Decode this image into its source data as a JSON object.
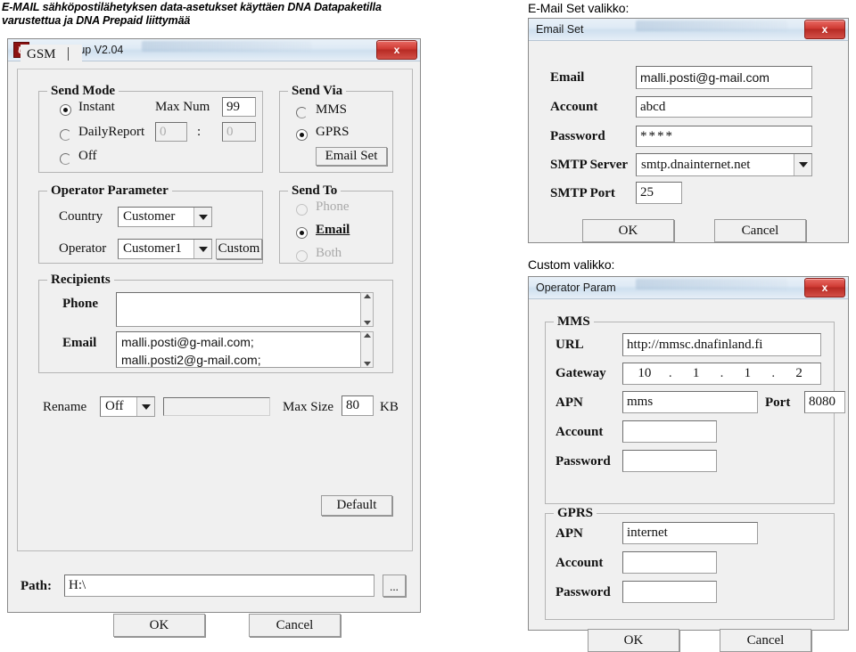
{
  "captions": {
    "heading_line1": "E-MAIL sähköpostilähetyksen data-asetukset käyttäen DNA Datapaketilla",
    "heading_line2": "varustettua ja DNA Prepaid liittymää",
    "email_set_caption": "E-Mail Set valikko:",
    "custom_caption": "Custom valikko:"
  },
  "main_window": {
    "title": "UOV Setup V2.04",
    "app_icon_letter": "U",
    "close_label": "x",
    "tab": {
      "label": "GSM"
    },
    "send_mode": {
      "legend": "Send Mode",
      "options": [
        {
          "label": "Instant",
          "selected": true,
          "disabled": false
        },
        {
          "label": "DailyReport",
          "selected": false,
          "disabled": false
        },
        {
          "label": "Off",
          "selected": false,
          "disabled": false
        }
      ],
      "max_num_label": "Max Num",
      "max_num_value": "99",
      "daily_hour_value": "0",
      "daily_separator": ":",
      "daily_minute_value": "0"
    },
    "send_via": {
      "legend": "Send Via",
      "options": [
        {
          "label": "MMS",
          "selected": false
        },
        {
          "label": "GPRS",
          "selected": true
        }
      ],
      "email_set_button": "Email Set"
    },
    "send_to": {
      "legend": "Send To",
      "options": [
        {
          "label": "Phone",
          "selected": false,
          "disabled": true
        },
        {
          "label": "Email",
          "selected": true,
          "disabled": false
        },
        {
          "label": "Both",
          "selected": false,
          "disabled": true
        }
      ]
    },
    "operator_parameter": {
      "legend": "Operator Parameter",
      "country_label": "Country",
      "country_value": "Customer",
      "operator_label": "Operator",
      "operator_value": "Customer1",
      "custom_button": "Custom"
    },
    "recipients": {
      "legend": "Recipients",
      "phone_label": "Phone",
      "phone_value": "",
      "email_label": "Email",
      "email_line1": "malli.posti@g-mail.com;",
      "email_line2": "malli.posti2@g-mail.com;"
    },
    "rename_row": {
      "rename_label": "Rename",
      "rename_value": "Off",
      "rename_text_value": "",
      "max_size_label": "Max Size",
      "max_size_value": "80",
      "max_size_unit": "KB"
    },
    "default_button": "Default",
    "path_label": "Path:",
    "path_value": "H:\\",
    "browse_button": "...",
    "ok_button": "OK",
    "cancel_button": "Cancel"
  },
  "email_set_window": {
    "title": "Email Set",
    "close_label": "x",
    "fields": {
      "email_label": "Email",
      "email_value": "malli.posti@g-mail.com",
      "account_label": "Account",
      "account_value": "abcd",
      "password_label": "Password",
      "password_value": "****",
      "smtp_server_label": "SMTP Server",
      "smtp_server_value": "smtp.dnainternet.net",
      "smtp_port_label": "SMTP Port",
      "smtp_port_value": "25"
    },
    "ok_button": "OK",
    "cancel_button": "Cancel"
  },
  "operator_param_window": {
    "title": "Operator Param",
    "close_label": "x",
    "mms": {
      "legend": "MMS",
      "url_label": "URL",
      "url_value": "http://mmsc.dnafinland.fi",
      "gateway_label": "Gateway",
      "gateway_octets": [
        "10",
        "1",
        "1",
        "2"
      ],
      "apn_label": "APN",
      "apn_value": "mms",
      "port_label": "Port",
      "port_value": "8080",
      "account_label": "Account",
      "account_value": "",
      "password_label": "Password",
      "password_value": ""
    },
    "gprs": {
      "legend": "GPRS",
      "apn_label": "APN",
      "apn_value": "internet",
      "account_label": "Account",
      "account_value": "",
      "password_label": "Password",
      "password_value": ""
    },
    "ok_button": "OK",
    "cancel_button": "Cancel"
  }
}
